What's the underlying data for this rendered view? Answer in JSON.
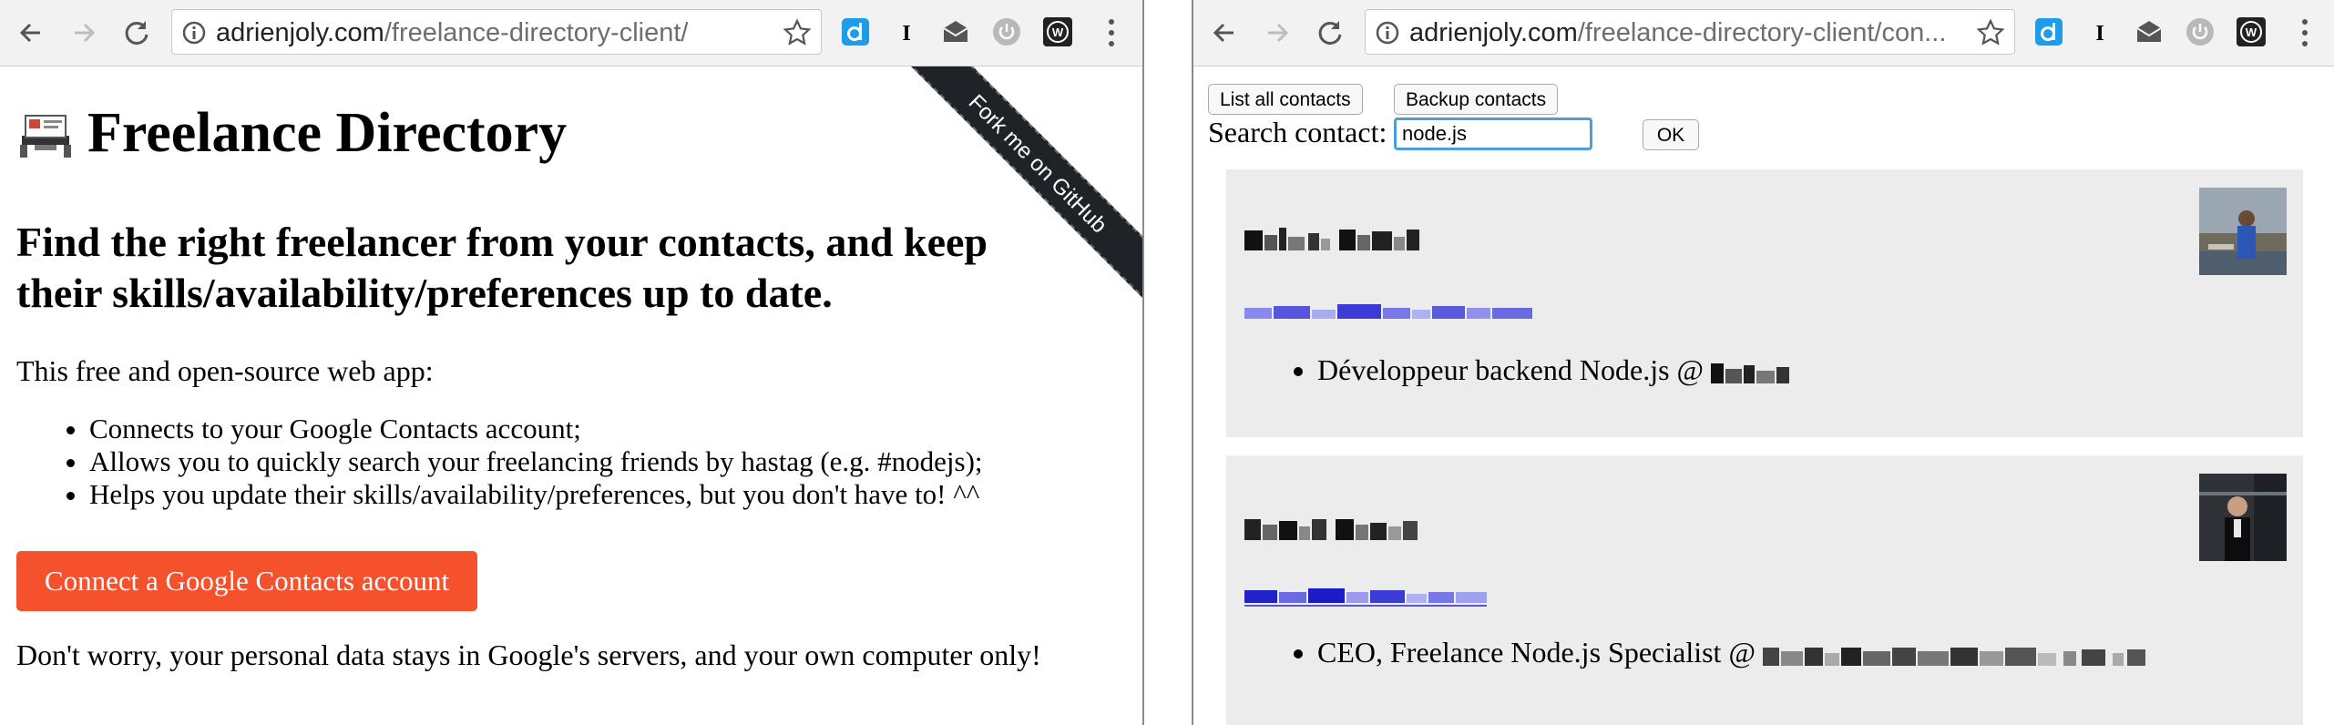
{
  "left_window": {
    "url_host": "adrienjoly.com",
    "url_path": "/freelance-directory-client/",
    "ribbon": "Fork me on GitHub",
    "title": "Freelance Directory",
    "tagline": "Find the right freelancer from your contacts, and keep their skills/availability/preferences up to date.",
    "intro": "This free and open-source web app:",
    "features": [
      "Connects to your Google Contacts account;",
      "Allows you to quickly search your freelancing friends by hastag (e.g. #nodejs);",
      "Helps you update their skills/availability/preferences, but you don't have to! ^^"
    ],
    "connect_button": "Connect a Google Contacts account",
    "footnote": "Don't worry, your personal data stays in Google's servers, and your own computer only!"
  },
  "right_window": {
    "url_host": "adrienjoly.com",
    "url_path": "/freelance-directory-client/con...",
    "list_button": "List all contacts",
    "backup_button": "Backup contacts",
    "search_label": "Search contact:",
    "search_value": "node.js",
    "ok_button": "OK",
    "contacts": [
      {
        "role": "Développeur backend Node.js @ "
      },
      {
        "role": "CEO, Freelance Node.js Specialist @ "
      }
    ]
  },
  "icons": [
    "back-arrow-icon",
    "forward-arrow-icon",
    "reload-icon",
    "info-icon",
    "star-icon",
    "extension-d-icon",
    "extension-i-icon",
    "extension-mail-icon",
    "extension-power-icon",
    "extension-w-icon",
    "menu-dots-icon"
  ],
  "colors": {
    "accent": "#f4512c",
    "focus": "#4c9ed9",
    "card": "#ececec",
    "link": "#4949e6"
  }
}
